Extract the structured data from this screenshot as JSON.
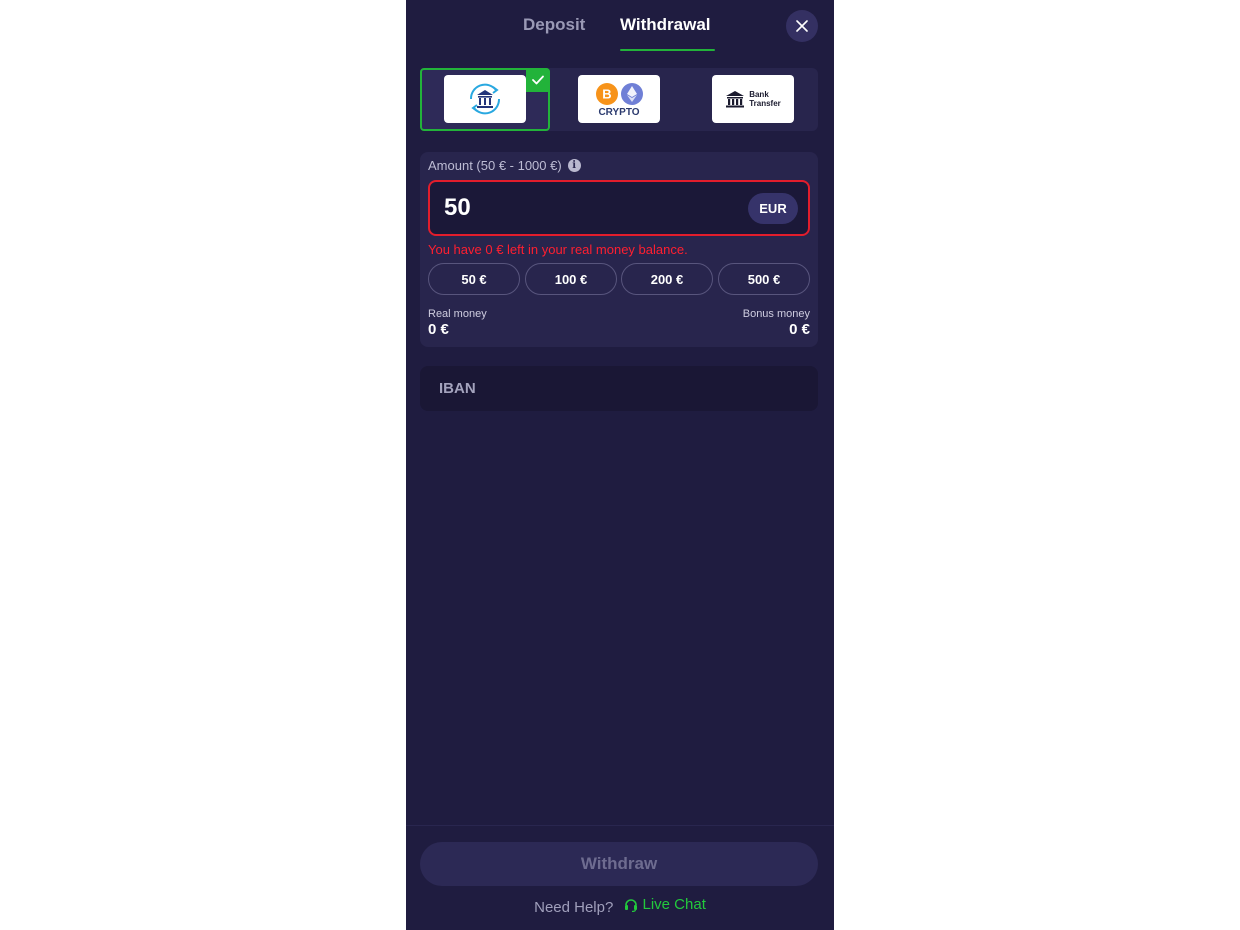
{
  "tabs": {
    "deposit": "Deposit",
    "withdrawal": "Withdrawal",
    "active": "withdrawal"
  },
  "methods": [
    {
      "id": "bank-sepa",
      "icon": "bank-sync-icon",
      "selected": true
    },
    {
      "id": "crypto",
      "label": "CRYPTO",
      "icon": "crypto-icon",
      "selected": false
    },
    {
      "id": "bank-transfer",
      "label_line1": "Bank",
      "label_line2": "Transfer",
      "icon": "bank-icon",
      "selected": false
    }
  ],
  "amount": {
    "label": "Amount (50 € - 1000 €)",
    "value": "50",
    "currency": "EUR",
    "error": "You have 0 € left in your real money balance.",
    "presets": [
      "50 €",
      "100 €",
      "200 €",
      "500 €"
    ]
  },
  "balance": {
    "real_label": "Real money",
    "real_value": "0 €",
    "bonus_label": "Bonus money",
    "bonus_value": "0 €"
  },
  "iban": {
    "label": "IBAN"
  },
  "footer": {
    "withdraw_label": "Withdraw",
    "help_text": "Need Help?",
    "live_chat": "Live Chat"
  },
  "colors": {
    "panel_bg": "#1f1c40",
    "accent_green": "#22b33a",
    "error_red": "#e21d2c"
  }
}
